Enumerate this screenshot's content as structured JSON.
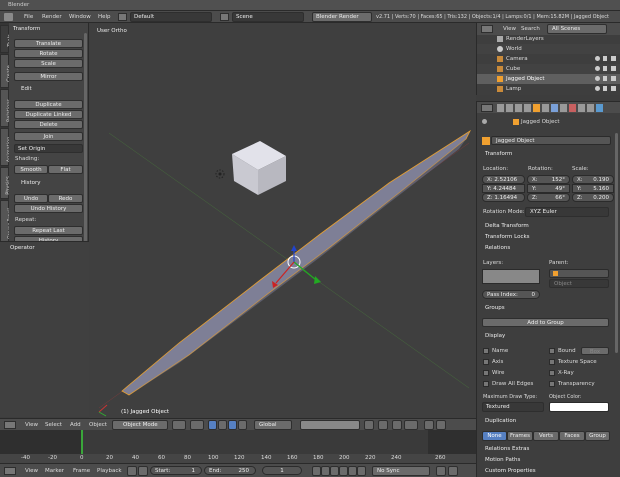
{
  "topbar": {
    "app": "Blender",
    "menus": [
      "File",
      "Render",
      "Window",
      "Help"
    ],
    "layout": "Default",
    "scene": "Scene",
    "engine": "Blender Render",
    "stats": "v2.71 | Verts:70 | Faces:65 | Tris:132 | Objects:1/4 | Lamps:0/1 | Mem:15.82M | Jagged Object"
  },
  "vtabs": [
    "Tools",
    "Create",
    "Relations",
    "Animation",
    "Physics",
    "Grease Pencil"
  ],
  "toolshelf": {
    "transform_title": "Transform",
    "translate": "Translate",
    "rotate": "Rotate",
    "scale": "Scale",
    "mirror": "Mirror",
    "edit_title": "Edit",
    "duplicate": "Duplicate",
    "duplicate_linked": "Duplicate Linked",
    "delete": "Delete",
    "join": "Join",
    "set_origin": "Set Origin",
    "shading_label": "Shading:",
    "smooth": "Smooth",
    "flat": "Flat",
    "history_title": "History",
    "undo": "Undo",
    "redo": "Redo",
    "undo_history": "Undo History",
    "repeat_label": "Repeat:",
    "repeat_last": "Repeat Last",
    "history": "History",
    "operator_title": "Operator"
  },
  "viewport": {
    "view_label": "User Ortho",
    "object_label": "(1) Jagged Object",
    "header": {
      "menus": [
        "View",
        "Select",
        "Add",
        "Object"
      ],
      "mode": "Object Mode",
      "orientation": "Global"
    }
  },
  "timeline": {
    "ticks": [
      "-40",
      "-20",
      "0",
      "20",
      "40",
      "60",
      "80",
      "100",
      "120",
      "140",
      "160",
      "180",
      "200",
      "220",
      "240",
      "260"
    ],
    "menus": [
      "View",
      "Marker",
      "Frame",
      "Playback"
    ],
    "start": "Start:",
    "start_val": "1",
    "end": "End:",
    "end_val": "250",
    "current": "1",
    "sync": "No Sync"
  },
  "outliner": {
    "header_menus": [
      "View",
      "Search"
    ],
    "filter": "All Scenes",
    "items": [
      "RenderLayers",
      "World",
      "Camera",
      "Cube",
      "Jagged Object",
      "Lamp"
    ]
  },
  "properties": {
    "breadcrumb": "Jagged Object",
    "name": "Jagged Object",
    "transform_title": "Transform",
    "location_label": "Location:",
    "rotation_label": "Rotation:",
    "scale_label": "Scale:",
    "location": [
      "2.52106",
      "4.24484",
      "1.16494"
    ],
    "rotation": [
      "152°",
      "49°",
      "66°"
    ],
    "scale": [
      "0.190",
      "5.160",
      "0.200"
    ],
    "axis": [
      "X:",
      "Y:",
      "Z:"
    ],
    "rotation_mode_label": "Rotation Mode:",
    "rotation_mode": "XYZ Euler",
    "delta_transform": "Delta Transform",
    "transform_locks": "Transform Locks",
    "relations_title": "Relations",
    "layers_label": "Layers:",
    "parent_label": "Parent:",
    "parent_type": "Object",
    "pass_index_label": "Pass Index:",
    "pass_index": "0",
    "groups_title": "Groups",
    "add_to_group": "Add to Group",
    "display_title": "Display",
    "display_left": [
      "Name",
      "Axis",
      "Wire",
      "Draw All Edges"
    ],
    "display_right": [
      "Bound",
      "Texture Space",
      "X-Ray",
      "Transparency"
    ],
    "bound_type": "Box",
    "max_draw_type_label": "Maximum Draw Type:",
    "max_draw_type": "Textured",
    "object_color_label": "Object Color:",
    "duplication_title": "Duplication",
    "dup_tabs": [
      "None",
      "Frames",
      "Verts",
      "Faces",
      "Group"
    ],
    "relations_extras": "Relations Extras",
    "motion_paths": "Motion Paths",
    "custom_properties": "Custom Properties"
  }
}
